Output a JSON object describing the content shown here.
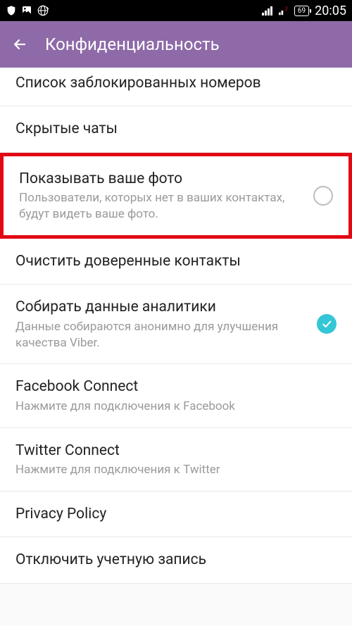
{
  "statusbar": {
    "battery_level": "69",
    "time": "20:05"
  },
  "appbar": {
    "title": "Конфиденциальность"
  },
  "items": {
    "blocked": {
      "title": "Список заблокированных номеров"
    },
    "hidden": {
      "title": "Скрытые чаты"
    },
    "showphoto": {
      "title": "Показывать ваше фото",
      "subtitle": "Пользователи, которых нет в ваших контактах, будут видеть ваше фото."
    },
    "cleartrusted": {
      "title": "Очистить доверенные контакты"
    },
    "analytics": {
      "title": "Собирать данные аналитики",
      "subtitle": "Данные собираются анонимно для улучшения качества Viber."
    },
    "facebook": {
      "title": "Facebook Connect",
      "subtitle": "Нажмите для подключения к Facebook"
    },
    "twitter": {
      "title": "Twitter Connect",
      "subtitle": "Нажмите для подключения к Twitter"
    },
    "privacy": {
      "title": "Privacy Policy"
    },
    "deactivate": {
      "title": "Отключить учетную запись"
    }
  }
}
